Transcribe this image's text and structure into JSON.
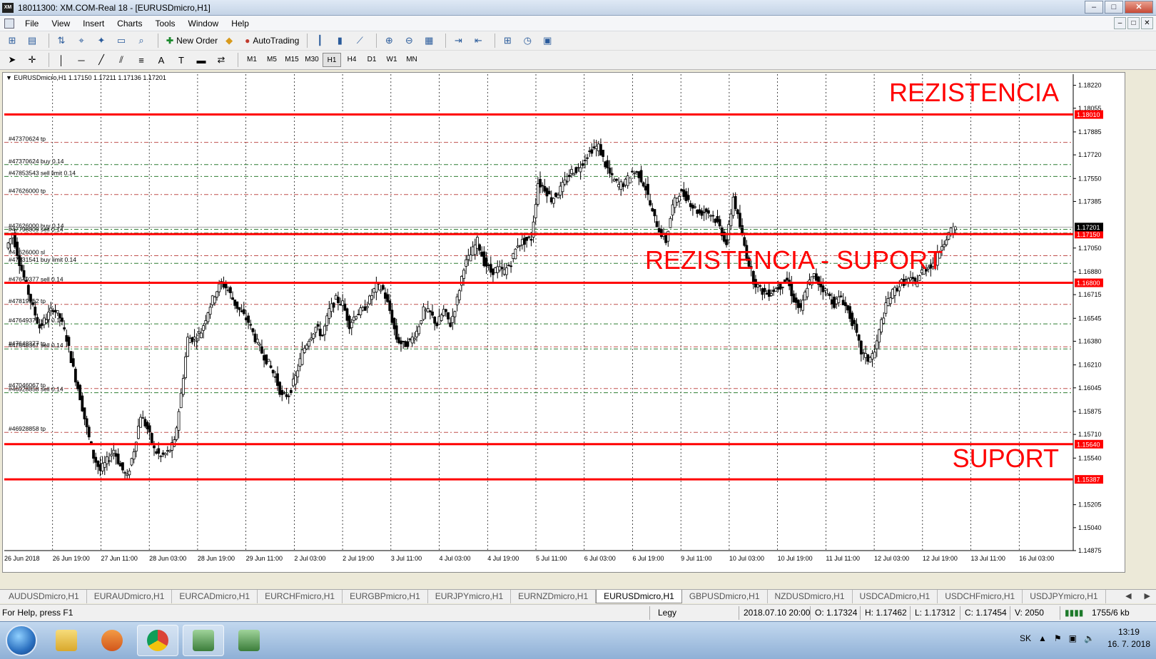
{
  "window": {
    "title": "18011300: XM.COM-Real 18 - [EURUSDmicro,H1]",
    "logo_text": "XM",
    "buttons": [
      "–",
      "□",
      "✕"
    ]
  },
  "menu": {
    "items": [
      "File",
      "View",
      "Insert",
      "Charts",
      "Tools",
      "Window",
      "Help"
    ],
    "mdi_buttons": [
      "–",
      "□",
      "✕"
    ]
  },
  "toolbar": {
    "new_order": "New Order",
    "autotrading": "AutoTrading"
  },
  "timeframes": {
    "items": [
      "M1",
      "M5",
      "M15",
      "M30",
      "H1",
      "H4",
      "D1",
      "W1",
      "MN"
    ],
    "active": "H1"
  },
  "chart_data": {
    "type": "candlestick",
    "header": "EURUSDmicro,H1  1.17150 1.17211 1.17136 1.17201",
    "symbol": "EURUSDmicro",
    "timeframe": "H1",
    "last_ohlc": {
      "open": 1.1715,
      "high": 1.17211,
      "low": 1.17136,
      "close": 1.17201
    },
    "ylim": [
      1.14875,
      1.183
    ],
    "y_ticks": [
      1.1822,
      1.18055,
      1.17885,
      1.1772,
      1.1755,
      1.17385,
      1.1705,
      1.1688,
      1.16715,
      1.16545,
      1.1638,
      1.1621,
      1.16045,
      1.15875,
      1.1571,
      1.1554,
      1.15205,
      1.1504,
      1.14875
    ],
    "x_labels": [
      "26 Jun 2018",
      "26 Jun 19:00",
      "27 Jun 11:00",
      "28 Jun 03:00",
      "28 Jun 19:00",
      "29 Jun 11:00",
      "2 Jul 03:00",
      "2 Jul 19:00",
      "3 Jul 11:00",
      "4 Jul 03:00",
      "4 Jul 19:00",
      "5 Jul 11:00",
      "6 Jul 03:00",
      "6 Jul 19:00",
      "9 Jul 11:00",
      "10 Jul 03:00",
      "10 Jul 19:00",
      "11 Jul 11:00",
      "12 Jul 03:00",
      "12 Jul 19:00",
      "13 Jul 11:00",
      "16 Jul 03:00"
    ],
    "price_path": [
      [
        0,
        1.1705
      ],
      [
        1,
        1.1715
      ],
      [
        2,
        1.1695
      ],
      [
        3,
        1.1678
      ],
      [
        4,
        1.1662
      ],
      [
        5,
        1.1648
      ],
      [
        6,
        1.1655
      ],
      [
        7,
        1.1662
      ],
      [
        8,
        1.1655
      ],
      [
        9,
        1.164
      ],
      [
        10,
        1.1618
      ],
      [
        11,
        1.1598
      ],
      [
        12,
        1.1575
      ],
      [
        13,
        1.1555
      ],
      [
        14,
        1.1545
      ],
      [
        15,
        1.1552
      ],
      [
        16,
        1.156
      ],
      [
        17,
        1.1548
      ],
      [
        18,
        1.154
      ],
      [
        19,
        1.156
      ],
      [
        20,
        1.1585
      ],
      [
        21,
        1.1575
      ],
      [
        22,
        1.156
      ],
      [
        23,
        1.1555
      ],
      [
        24,
        1.1558
      ],
      [
        25,
        1.1565
      ],
      [
        26,
        1.16
      ],
      [
        27,
        1.164
      ],
      [
        28,
        1.164
      ],
      [
        29,
        1.1645
      ],
      [
        30,
        1.166
      ],
      [
        31,
        1.1672
      ],
      [
        32,
        1.168
      ],
      [
        33,
        1.1675
      ],
      [
        34,
        1.1665
      ],
      [
        35,
        1.1658
      ],
      [
        36,
        1.1652
      ],
      [
        37,
        1.164
      ],
      [
        38,
        1.163
      ],
      [
        39,
        1.1622
      ],
      [
        40,
        1.1612
      ],
      [
        41,
        1.1598
      ],
      [
        42,
        1.16
      ],
      [
        43,
        1.1612
      ],
      [
        44,
        1.163
      ],
      [
        45,
        1.164
      ],
      [
        46,
        1.1648
      ],
      [
        47,
        1.1642
      ],
      [
        48,
        1.166
      ],
      [
        49,
        1.1668
      ],
      [
        50,
        1.1665
      ],
      [
        51,
        1.165
      ],
      [
        52,
        1.1658
      ],
      [
        53,
        1.166
      ],
      [
        54,
        1.1668
      ],
      [
        55,
        1.1678
      ],
      [
        56,
        1.1675
      ],
      [
        57,
        1.166
      ],
      [
        58,
        1.164
      ],
      [
        59,
        1.1635
      ],
      [
        60,
        1.1638
      ],
      [
        61,
        1.1645
      ],
      [
        62,
        1.166
      ],
      [
        63,
        1.1658
      ],
      [
        64,
        1.165
      ],
      [
        65,
        1.166
      ],
      [
        66,
        1.165
      ],
      [
        67,
        1.1668
      ],
      [
        68,
        1.1692
      ],
      [
        69,
        1.17
      ],
      [
        70,
        1.171
      ],
      [
        71,
        1.1695
      ],
      [
        72,
        1.1688
      ],
      [
        73,
        1.169
      ],
      [
        74,
        1.1688
      ],
      [
        75,
        1.1695
      ],
      [
        76,
        1.1708
      ],
      [
        77,
        1.171
      ],
      [
        78,
        1.1712
      ],
      [
        79,
        1.1752
      ],
      [
        80,
        1.1748
      ],
      [
        81,
        1.174
      ],
      [
        82,
        1.1745
      ],
      [
        83,
        1.1752
      ],
      [
        84,
        1.176
      ],
      [
        85,
        1.1762
      ],
      [
        86,
        1.177
      ],
      [
        87,
        1.1776
      ],
      [
        88,
        1.1778
      ],
      [
        89,
        1.1765
      ],
      [
        90,
        1.1755
      ],
      [
        91,
        1.175
      ],
      [
        92,
        1.1752
      ],
      [
        93,
        1.176
      ],
      [
        94,
        1.1758
      ],
      [
        95,
        1.1748
      ],
      [
        96,
        1.173
      ],
      [
        97,
        1.1718
      ],
      [
        98,
        1.171
      ],
      [
        99,
        1.1735
      ],
      [
        100,
        1.1745
      ],
      [
        101,
        1.1742
      ],
      [
        102,
        1.1735
      ],
      [
        103,
        1.173
      ],
      [
        104,
        1.1732
      ],
      [
        105,
        1.1728
      ],
      [
        106,
        1.172
      ],
      [
        107,
        1.1708
      ],
      [
        108,
        1.1742
      ],
      [
        109,
        1.172
      ],
      [
        110,
        1.17
      ],
      [
        111,
        1.1682
      ],
      [
        112,
        1.1675
      ],
      [
        113,
        1.1672
      ],
      [
        114,
        1.1675
      ],
      [
        115,
        1.1678
      ],
      [
        116,
        1.1682
      ],
      [
        117,
        1.1668
      ],
      [
        118,
        1.166
      ],
      [
        119,
        1.1678
      ],
      [
        120,
        1.1685
      ],
      [
        121,
        1.1678
      ],
      [
        122,
        1.1672
      ],
      [
        123,
        1.1665
      ],
      [
        124,
        1.167
      ],
      [
        125,
        1.166
      ],
      [
        126,
        1.1648
      ],
      [
        127,
        1.163
      ],
      [
        128,
        1.1625
      ],
      [
        129,
        1.163
      ],
      [
        130,
        1.1652
      ],
      [
        131,
        1.1668
      ],
      [
        132,
        1.1675
      ],
      [
        133,
        1.168
      ],
      [
        134,
        1.1682
      ],
      [
        135,
        1.168
      ],
      [
        136,
        1.1688
      ],
      [
        137,
        1.1692
      ],
      [
        138,
        1.1695
      ],
      [
        139,
        1.1708
      ],
      [
        140,
        1.1715
      ],
      [
        141,
        1.172
      ]
    ]
  },
  "lines": {
    "red_levels": [
      {
        "price": 1.1801,
        "label": "1.18010"
      },
      {
        "price": 1.1715,
        "label": "1.17150"
      },
      {
        "price": 1.168,
        "label": "1.16800"
      },
      {
        "price": 1.1564,
        "label": "1.15640"
      },
      {
        "price": 1.15387,
        "label": "1.15387"
      }
    ],
    "current_price_label": "1.17201",
    "order_lines": [
      {
        "price": 1.1781,
        "label": "#47370624 tp",
        "kind": "tp"
      },
      {
        "price": 1.1765,
        "label": "#47370624 buy 0.14",
        "kind": "entry"
      },
      {
        "price": 1.17565,
        "label": "#47853543 sell limit 0.14",
        "kind": "entry"
      },
      {
        "price": 1.17435,
        "label": "#47626000 tp",
        "kind": "tp"
      },
      {
        "price": 1.17185,
        "label": "#47626000 buy 0.14",
        "kind": "entry"
      },
      {
        "price": 1.17158,
        "label": "#47798809 sell 0.14",
        "kind": "entry"
      },
      {
        "price": 1.16995,
        "label": "#47626000 sl",
        "kind": "sl"
      },
      {
        "price": 1.1694,
        "label": "#47831541 buy limit 0.14",
        "kind": "entry"
      },
      {
        "price": 1.168,
        "label": "#47649377 sell 0.14",
        "kind": "entry"
      },
      {
        "price": 1.16645,
        "label": "#47819162 tp",
        "kind": "tp"
      },
      {
        "price": 1.16505,
        "label": "#47649377 sell 0.14",
        "kind": "entry"
      },
      {
        "price": 1.1634,
        "label": "#47648377 tp",
        "kind": "tp"
      },
      {
        "price": 1.16325,
        "label": "#47648367 sell 0.14",
        "kind": "entry"
      },
      {
        "price": 1.1604,
        "label": "#47046067 tp",
        "kind": "tp"
      },
      {
        "price": 1.1601,
        "label": "#46928858 sell 0.14",
        "kind": "entry"
      },
      {
        "price": 1.15725,
        "label": "#46928858 tp",
        "kind": "tp"
      }
    ],
    "annotations": {
      "resistance": "REZISTENCIA",
      "resistance_support": "REZISTENCIA - SUPORT",
      "support": "SUPORT"
    },
    "colors": {
      "red": "#ff0000",
      "tp": "#c0504d",
      "entry": "#2e7d32",
      "candle": "#000000",
      "grid": "#000000"
    }
  },
  "tabs": {
    "items": [
      "AUDUSDmicro,H1",
      "EURAUDmicro,H1",
      "EURCADmicro,H1",
      "EURCHFmicro,H1",
      "EURGBPmicro,H1",
      "EURJPYmicro,H1",
      "EURNZDmicro,H1",
      "EURUSDmicro,H1",
      "GBPUSDmicro,H1",
      "NZDUSDmicro,H1",
      "USDCADmicro,H1",
      "USDCHFmicro,H1",
      "USDJPYmicro,H1"
    ],
    "active": "EURUSDmicro,H1"
  },
  "status": {
    "help": "For Help, press F1",
    "profile": "Legy",
    "datetime": "2018.07.10 20:00",
    "open": "O: 1.17324",
    "high": "H: 1.17462",
    "low": "L: 1.17312",
    "close": "C: 1.17454",
    "volume": "V: 2050",
    "traffic": "1755/6 kb"
  },
  "taskbar": {
    "lang": "SK",
    "time": "13:19",
    "date": "16. 7. 2018"
  }
}
